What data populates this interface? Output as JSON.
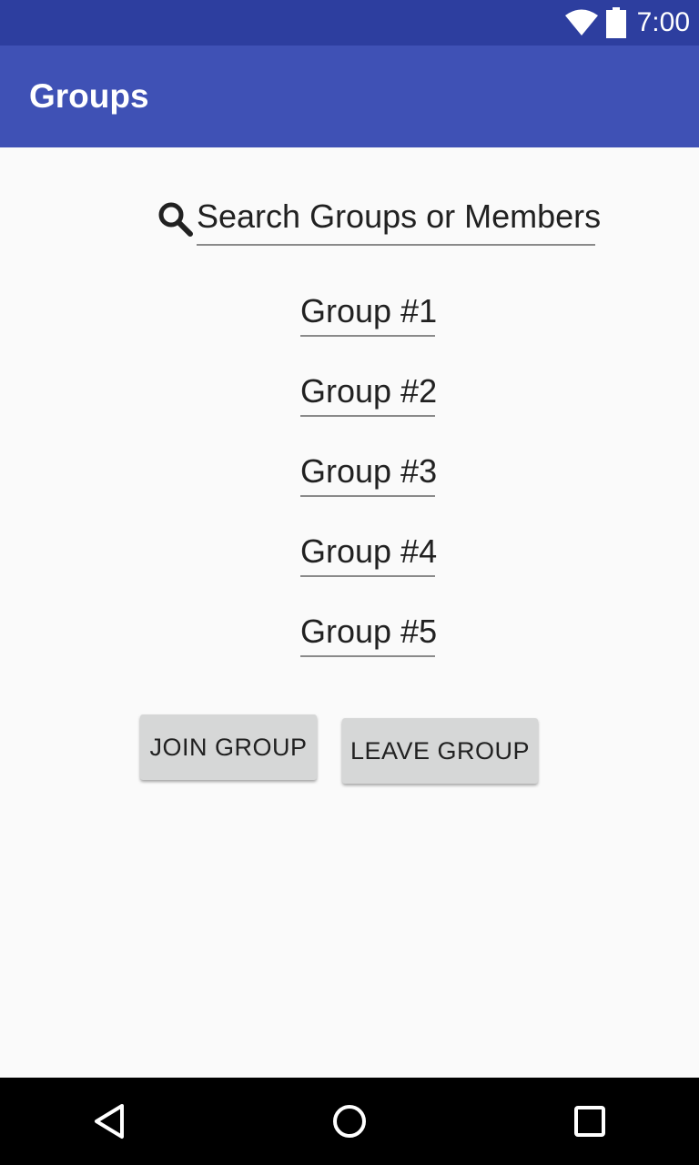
{
  "status_bar": {
    "time": "7:00",
    "icons": [
      "wifi-icon",
      "battery-icon"
    ]
  },
  "app_bar": {
    "title": "Groups",
    "color": "#3f51b5",
    "status_color": "#2d3e9f"
  },
  "search": {
    "icon": "search-icon",
    "text": "Search Groups or Members"
  },
  "groups": [
    {
      "label": "Group #1"
    },
    {
      "label": "Group #2"
    },
    {
      "label": "Group #3"
    },
    {
      "label": "Group #4"
    },
    {
      "label": "Group #5"
    }
  ],
  "actions": {
    "join_label": "JOIN GROUP",
    "leave_label": "LEAVE GROUP"
  },
  "nav_bar": {
    "icons": [
      "back-icon",
      "home-icon",
      "recents-icon"
    ]
  }
}
